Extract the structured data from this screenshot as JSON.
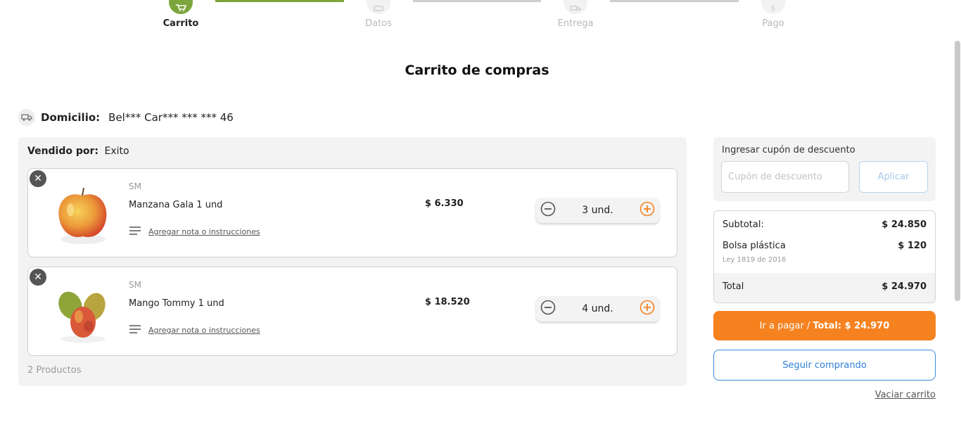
{
  "stepper": {
    "steps": [
      {
        "label": "Carrito",
        "icon": "cart-icon"
      },
      {
        "label": "Datos",
        "icon": "id-card-icon"
      },
      {
        "label": "Entrega",
        "icon": "truck-icon"
      },
      {
        "label": "Pago",
        "icon": "money-icon"
      }
    ],
    "active_color": "#7ca53c"
  },
  "page_title": "Carrito de compras",
  "address": {
    "label": "Domicilio:",
    "value": "Bel*** Car*** *** *** 46",
    "icon": "truck-icon"
  },
  "seller": {
    "label": "Vendido por:",
    "name": "Exito"
  },
  "products": [
    {
      "brand": "SM",
      "name": "Manzana Gala 1 und",
      "note_link": "Agregar nota o instrucciones",
      "price": "$ 6.330",
      "quantity": "3 und."
    },
    {
      "brand": "SM",
      "name": "Mango Tommy 1 und",
      "note_link": "Agregar nota o instrucciones",
      "price": "$ 18.520",
      "quantity": "4 und."
    }
  ],
  "product_count": "2 Productos",
  "coupon": {
    "label": "Ingresar cupón de descuento",
    "placeholder": "Cupón de descuento",
    "value": "",
    "apply_label": "Aplicar"
  },
  "summary": {
    "subtotal_label": "Subtotal:",
    "subtotal_value": "$ 24.850",
    "bag_label": "Bolsa plástica",
    "bag_value": "$ 120",
    "bag_law": "Ley 1819 de 2016",
    "total_label": "Total",
    "total_value": "$ 24.970"
  },
  "actions": {
    "pay_label": "Ir a pagar /",
    "pay_total": "Total: $ 24.970",
    "continue_label": "Seguir comprando",
    "empty_cart_label": "Vaciar carrito"
  },
  "colors": {
    "primary_orange": "#f5821f",
    "link_blue": "#2f80d8",
    "accent_green": "#7ca53c"
  }
}
